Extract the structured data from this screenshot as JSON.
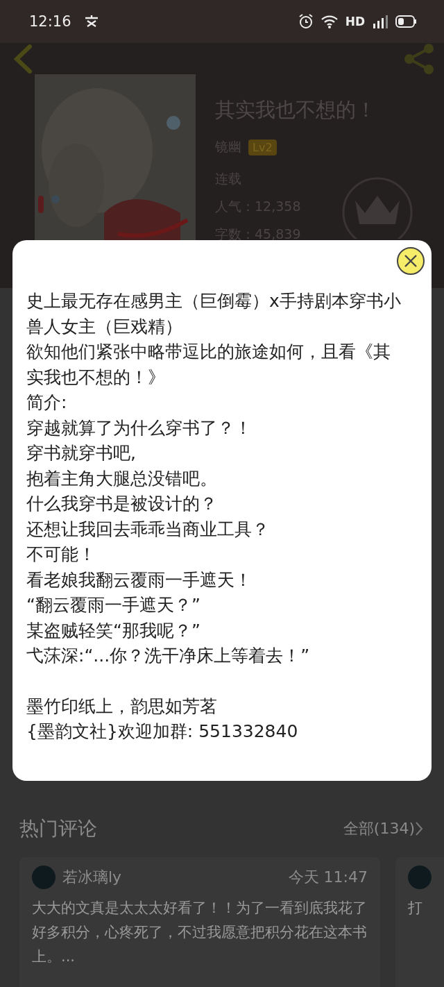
{
  "status_bar": {
    "time": "12:16",
    "network": "HD"
  },
  "book": {
    "title": "其实我也不想的！",
    "author": "镜幽",
    "level": "Lv2",
    "status": "连载",
    "popularity": "人气：12,358",
    "word_count": "字数：45,839"
  },
  "dialog": {
    "paragraphs": [
      [
        "史上最无存在感男主（巨倒霉）x手持剧本穿书小兽人女主（巨戏精）",
        "欲知他们紧张中略带逗比的旅途如何，且看《其实我也不想的！》",
        "简介:",
        "穿越就算了为什么穿书了？！",
        "穿书就穿书吧,",
        "抱着主角大腿总没错吧。",
        "什么我穿书是被设计的？",
        "还想让我回去乖乖当商业工具？",
        "不可能！",
        "看老娘我翻云覆雨一手遮天！",
        "“翻云覆雨一手遮天？”",
        "某盗贼轻笑“那我呢？”",
        "弋莯深:“...你？洗干净床上等着去！”"
      ],
      [
        "墨竹印纸上，韵思如芳茗",
        "{墨韵文社}欢迎加群: 551332840"
      ]
    ]
  },
  "comments": {
    "title": "热门评论",
    "all_link": "全部(134)",
    "items": [
      {
        "user": "若冰璃ly",
        "time": "今天 11:47",
        "text": "大大的文真是太太太好看了！！为了一看到底我花了好多积分，心疼死了，不过我愿意把积分花在这本书上。..."
      },
      {
        "text": "打"
      }
    ]
  }
}
